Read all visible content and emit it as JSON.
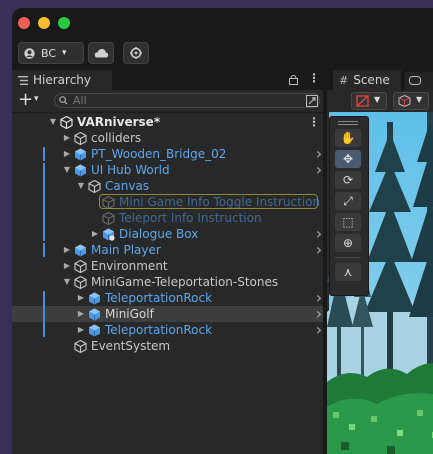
{
  "toolbar": {
    "account_label": "BC",
    "account_chevron": "▾",
    "cloud_icon": "cloud-icon",
    "settings_icon": "settings-icon"
  },
  "hierarchy": {
    "tab_label": "Hierarchy",
    "add_label": "+",
    "add_chevron": "▾",
    "search_placeholder": "All",
    "rows": [
      {
        "label": "VARniverse*",
        "depth": 0,
        "arrow": "down",
        "icon": "unity-scene-icon",
        "color": "#e6e6e6",
        "bold": true
      },
      {
        "label": "colliders",
        "depth": 1,
        "arrow": "right",
        "icon": "gameobject-outline-icon",
        "color": "#c8c8c8"
      },
      {
        "label": "PT_Wooden_Bridge_02",
        "depth": 1,
        "arrow": "right",
        "icon": "prefab-icon",
        "color": "#5aa8f0",
        "chev": true
      },
      {
        "label": "UI Hub World",
        "depth": 1,
        "arrow": "down",
        "icon": "prefab-icon",
        "color": "#5aa8f0",
        "chev": true
      },
      {
        "label": "Canvas",
        "depth": 2,
        "arrow": "down",
        "icon": "gameobject-outline-icon",
        "color": "#5aa8f0"
      },
      {
        "label": "Mini Game Info Toggle Instruction",
        "depth": 3,
        "arrow": "",
        "icon": "gameobject-outline-dim-icon",
        "color": "#3f6a98",
        "highlight": true
      },
      {
        "label": "Teleport Info Instruction",
        "depth": 3,
        "arrow": "",
        "icon": "gameobject-outline-dim-icon",
        "color": "#3f6a98"
      },
      {
        "label": "Dialogue Box",
        "depth": 3,
        "arrow": "right",
        "icon": "prefab-variant-icon",
        "color": "#5aa8f0",
        "chev": true
      },
      {
        "label": "Main Player",
        "depth": 1,
        "arrow": "right",
        "icon": "prefab-icon",
        "color": "#5aa8f0",
        "chev": true
      },
      {
        "label": "Environment",
        "depth": 1,
        "arrow": "right",
        "icon": "gameobject-outline-icon",
        "color": "#c8c8c8"
      },
      {
        "label": "MiniGame-Teleportation-Stones",
        "depth": 1,
        "arrow": "down",
        "icon": "gameobject-outline-icon",
        "color": "#c8c8c8"
      },
      {
        "label": "TeleportationRock",
        "depth": 2,
        "arrow": "right",
        "icon": "prefab-icon",
        "color": "#5aa8f0",
        "chev": true
      },
      {
        "label": "MiniGolf",
        "depth": 2,
        "arrow": "right",
        "icon": "prefab-icon",
        "color": "#d6d6d6",
        "chev": true,
        "selected": true
      },
      {
        "label": "TeleportationRock",
        "depth": 2,
        "arrow": "right",
        "icon": "prefab-icon",
        "color": "#5aa8f0",
        "chev": true
      },
      {
        "label": "EventSystem",
        "depth": 1,
        "arrow": "",
        "icon": "gameobject-outline-icon",
        "color": "#c8c8c8"
      }
    ]
  },
  "scene": {
    "tab_label": "Scene",
    "tools": [
      "hand-tool-icon",
      "move-tool-icon",
      "rotate-tool-icon",
      "scale-tool-icon",
      "rect-tool-icon",
      "transform-tool-icon",
      "custom-tool-icon"
    ]
  },
  "colors": {
    "accent_blue": "#5aa8f0",
    "prefab_blue": "#4a8fd6",
    "background": "#282828",
    "selection_outline": "#8a8a3a"
  }
}
